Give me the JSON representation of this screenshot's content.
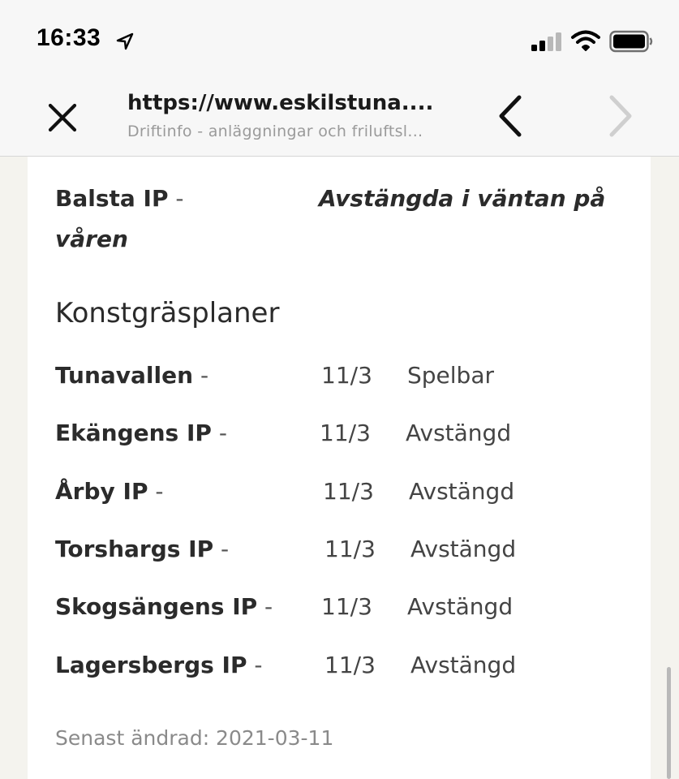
{
  "status_bar": {
    "time": "16:33",
    "icons": [
      "location-arrow-icon",
      "signal-icon",
      "wifi-icon",
      "battery-icon"
    ]
  },
  "browser": {
    "url": "https://www.eskilstuna....",
    "page_title": "Driftinfo - anläggningar och friluftsl...",
    "icons": [
      "close-icon",
      "chevron-left-icon",
      "chevron-right-icon"
    ]
  },
  "content": {
    "partial_row": {
      "name": "Balsta IP",
      "dash": "-",
      "status_line1": "Avstängda i väntan på",
      "status_line2": "våren"
    },
    "section_heading": "Konstgräsplaner",
    "fields": [
      {
        "name": "Tunavallen",
        "dash": "-",
        "date": "11/3",
        "status": "Spelbar"
      },
      {
        "name": "Ekängens IP",
        "dash": "-",
        "date": "11/3",
        "status": "Avstängd"
      },
      {
        "name": "Årby IP",
        "dash": "-",
        "date": "11/3",
        "status": "Avstängd"
      },
      {
        "name": "Torshargs IP",
        "dash": "-",
        "date": "11/3",
        "status": "Avstängd"
      },
      {
        "name": "Skogsängens IP",
        "dash": "-",
        "date": "11/3",
        "status": "Avstängd"
      },
      {
        "name": "Lagersbergs IP",
        "dash": "-",
        "date": "11/3",
        "status": "Avstängd"
      }
    ],
    "last_changed": "Senast ändrad: 2021-03-11"
  },
  "colors": {
    "page_background": "#f4f3ee",
    "card_background": "#ffffff",
    "text": "#2b2b2b",
    "muted_text": "#8a8a8a"
  }
}
